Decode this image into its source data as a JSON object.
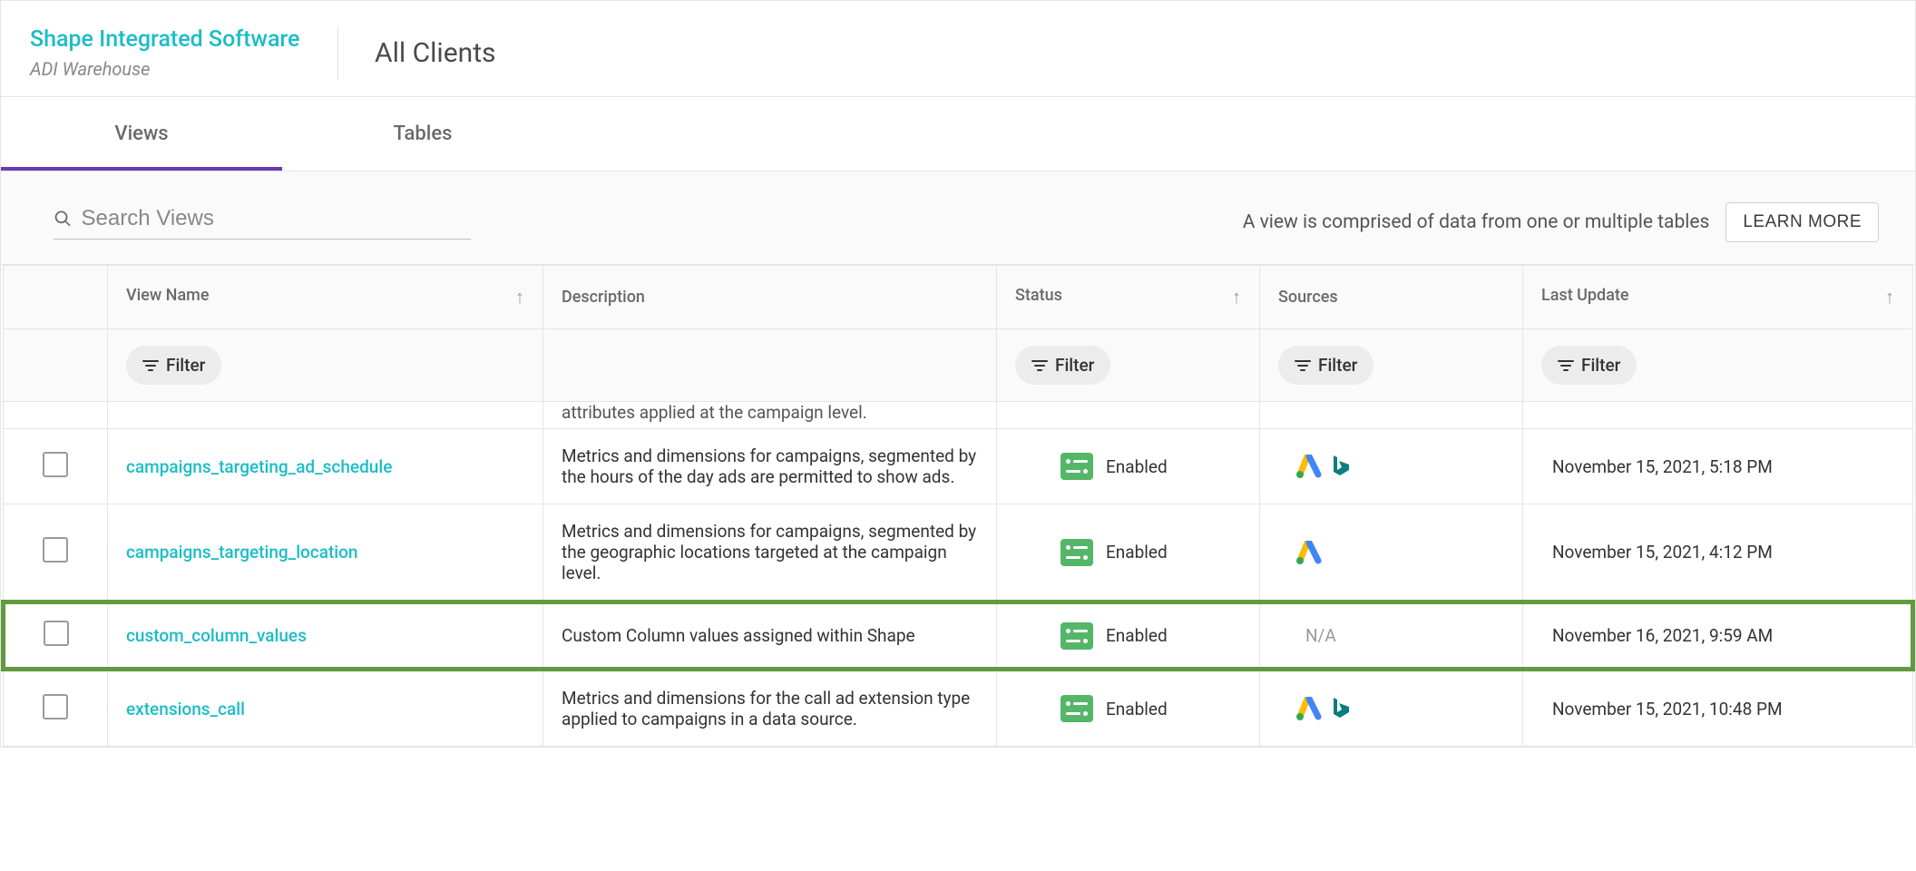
{
  "header": {
    "brand": "Shape Integrated Software",
    "subtitle": "ADI Warehouse",
    "title": "All Clients"
  },
  "tabs": {
    "views": "Views",
    "tables": "Tables"
  },
  "toolbar": {
    "search_placeholder": "Search Views",
    "info_text": "A view is comprised of data from one or multiple tables",
    "learn_more": "LEARN MORE"
  },
  "columns": {
    "name": "View Name",
    "description": "Description",
    "status": "Status",
    "sources": "Sources",
    "updated": "Last Update",
    "filter_label": "Filter"
  },
  "partial_row": {
    "description": "attributes applied at the campaign level."
  },
  "rows": [
    {
      "name": "campaigns_targeting_ad_schedule",
      "description": "Metrics and dimensions for campaigns, segmented by the hours of the day ads are permitted to show ads.",
      "status": "Enabled",
      "sources": "google_bing",
      "updated": "November 15, 2021, 5:18 PM"
    },
    {
      "name": "campaigns_targeting_location",
      "description": "Metrics and dimensions for campaigns, segmented by the geographic locations targeted at the campaign level.",
      "status": "Enabled",
      "sources": "google",
      "updated": "November 15, 2021, 4:12 PM"
    },
    {
      "name": "custom_column_values",
      "description": "Custom Column values assigned within Shape",
      "status": "Enabled",
      "sources": "N/A",
      "updated": "November 16, 2021, 9:59 AM"
    },
    {
      "name": "extensions_call",
      "description": "Metrics and dimensions for the call ad extension type applied to campaigns in a data source.",
      "status": "Enabled",
      "sources": "google_bing",
      "updated": "November 15, 2021, 10:48 PM"
    }
  ]
}
